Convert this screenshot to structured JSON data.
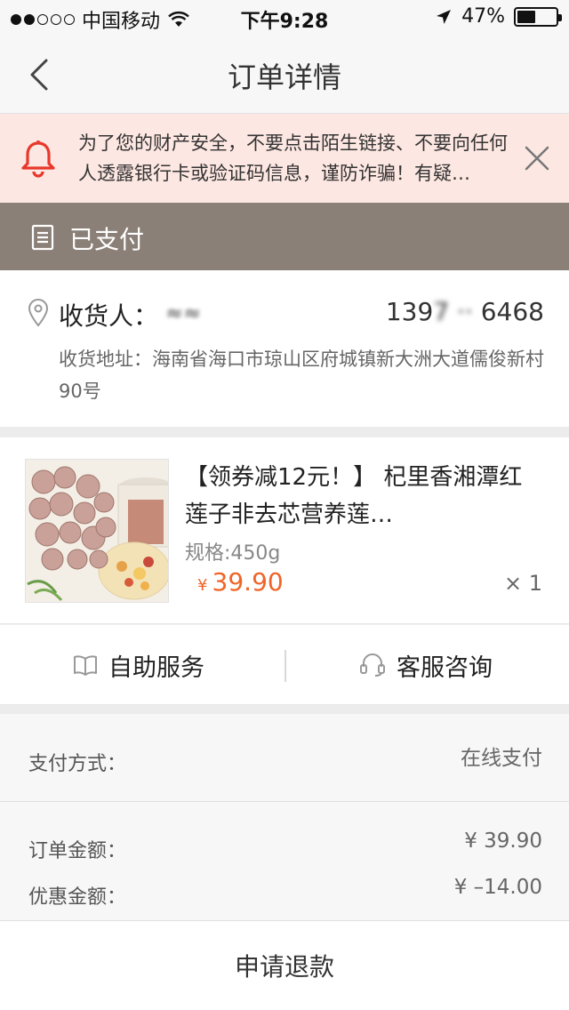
{
  "status_bar": {
    "carrier": "中国移动",
    "time": "下午9:28",
    "battery": "47%",
    "battery_level": 0.47
  },
  "nav": {
    "title": "订单详情"
  },
  "warning": {
    "text": "为了您的财产安全，不要点击陌生链接、不要向任何人透露银行卡或验证码信息，谨防诈骗！有疑…"
  },
  "order_status": {
    "label": "已支付"
  },
  "address": {
    "receiver_label": "收货人：",
    "receiver_name": "≈≈",
    "receiver_phone_prefix": "139",
    "receiver_phone_hidden": "7  ··  ",
    "receiver_phone_suffix": "6468",
    "address_label": "收货地址：",
    "address_text": "海南省海口市琼山区府城镇新大洲大道儒俊新村90号"
  },
  "product": {
    "title": "【领券减12元！】 杞里香湘潭红莲子非去芯营养莲…",
    "spec": "规格:450g",
    "price_symbol": "¥",
    "price": "39.90",
    "quantity": "× 1"
  },
  "service": {
    "self_service": "自助服务",
    "customer_service": "客服咨询"
  },
  "payment": {
    "method_label": "支付方式：",
    "method_value": "在线支付",
    "order_amount_label": "订单金额：",
    "order_amount_value": "¥ 39.90",
    "discount_label": "优惠金额：",
    "discount_value": "¥ –14.00"
  },
  "bottom": {
    "refund_label": "申请退款"
  }
}
